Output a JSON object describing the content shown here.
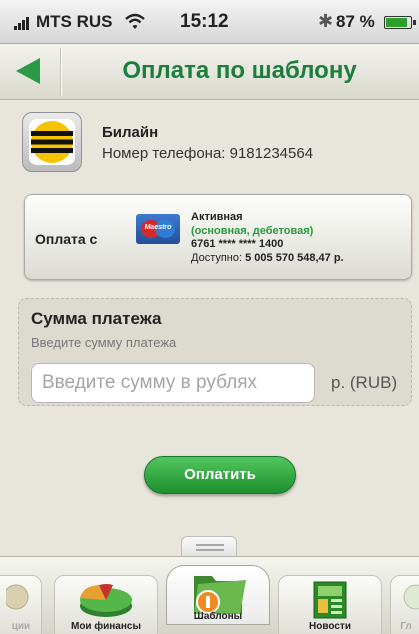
{
  "status_bar": {
    "carrier": "MTS RUS",
    "time": "15:12",
    "battery": "87 %"
  },
  "nav": {
    "title": "Оплата по шаблону"
  },
  "provider": {
    "name": "Билайн",
    "phone": "Номер телефона: 9181234564"
  },
  "payment_source": {
    "label": "Оплата с",
    "card_brand": "Maestro",
    "status": "Активная",
    "type": "(основная, дебетовая)",
    "number": "6761 **** **** 1400",
    "available_label": "Доступно: ",
    "available_amount": "5 005 570 548,47 р."
  },
  "amount": {
    "title": "Сумма платежа",
    "hint": "Введите сумму платежа",
    "placeholder": "Введите сумму в рублях",
    "value": "",
    "currency": "р. (RUB)"
  },
  "actions": {
    "pay_label": "Оплатить"
  },
  "tabbar": {
    "tabs": [
      {
        "label": "ции"
      },
      {
        "label": "Мои финансы"
      },
      {
        "label": "Шаблоны",
        "active": true
      },
      {
        "label": "Новости"
      },
      {
        "label": "Гл"
      }
    ]
  },
  "colors": {
    "accent_green": "#1b7e3c",
    "button_green": "#2faa3f",
    "beeline_yellow": "#f5c400"
  },
  "icons": [
    "signal-icon",
    "wifi-icon",
    "bluetooth-icon",
    "battery-icon",
    "back-arrow-icon",
    "beeline-logo-icon",
    "maestro-card-icon",
    "pie-chart-icon",
    "folder-icon",
    "news-icon"
  ]
}
